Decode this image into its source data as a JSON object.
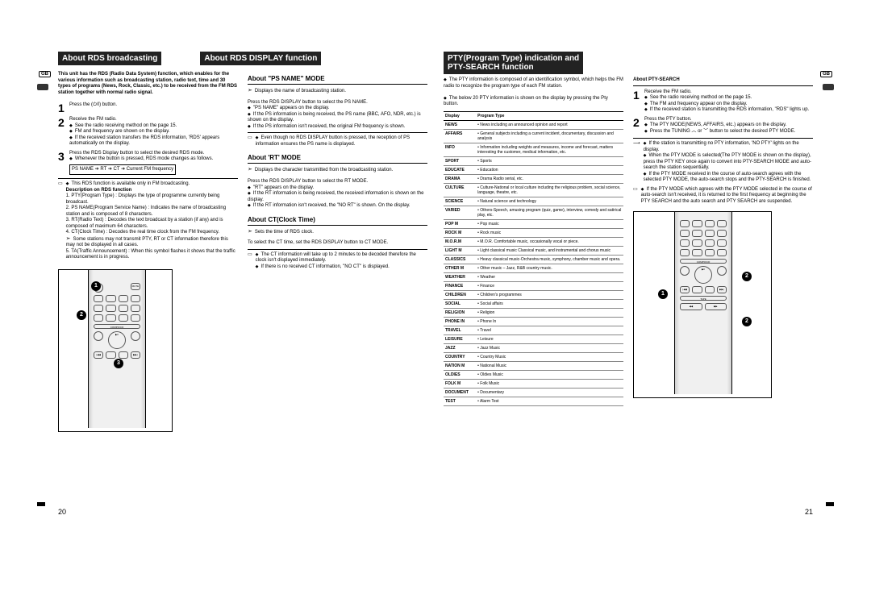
{
  "page_left_number": "20",
  "page_right_number": "21",
  "gb_badge": "GB",
  "headers": {
    "h1": "About RDS broadcasting",
    "h2": "About RDS DISPLAY function",
    "h3a": "PTY(Program Type) indication and",
    "h3b": "PTY-SEARCH function"
  },
  "left_intro": "This unit has the RDS (Radio Data System) function, which enables for the various information such as broadcasting station, radio text, time and 30 types of programs (News, Rock, Classic, etc.) to be received from the FM RDS station together with normal radio signal.",
  "left_steps": {
    "s1": "Press the (⏻/I) button.",
    "s2_a": "Receive the FM radio.",
    "s2_b": "See the radio receiving method on the page 15.",
    "s2_c": "FM and frequency are shown on the display.",
    "s2_d": "If the received station transfers the RDS information, 'RDS' appears automatically on the display.",
    "s3_a": "Press the RDS Display button to select the desired RDS mode.",
    "s3_b": "Whenever the button is pressed, RDS mode changes as follows.",
    "s3_flow": "PS NAME ➔ RT ➔ CT ➔ Current FM frequency"
  },
  "left_notes": {
    "intro": "This RDS function is available only in FM broadcasting.",
    "desc_head": "Description on RDS function",
    "n1": "1. PTY(Program Type) : Displays the type of programme currently being broadcast.",
    "n2": "2. PS NAME(Program Service Name) : Indicates the name of broadcasting station and is composed of 8 characters.",
    "n3": "3. RT(Radio Text) : Decodes the text broadcast by a station (if any) and is composed of maximum 64 characters.",
    "n4": "4. CT(Clock Time) : Decodes the real time clock from the FM frequency.",
    "n4b": "Some stations may not transmit PTY, RT or CT information therefore this may not be displayed in all cases.",
    "n5": "5. TA(Traffic Announcement) : When this symbol flashes it shows that the traffic announcement is in progress."
  },
  "mid_ps": {
    "head": "About \"PS NAME\" MODE",
    "p1": "Displays the name of broadcasting station.",
    "p2": "Press the RDS DISPLAY button to select the PS NAME.",
    "p3": "\"PS NAME\" appears on the display.",
    "p4": "If the PS information is being received, the PS name (BBC, AFO, NDR, etc.) is shown on the display.",
    "p5": "If the PS information isn't received, the original FM frequency is shown.",
    "note": "Even though no RDS DISPLAY button is pressed, the reception of PS information ensures the PS name is displayed."
  },
  "mid_rt": {
    "head": "About 'RT' MODE",
    "p1": "Displays the character transmitted from the broadcasting station.",
    "p2": "Press the RDS DISPLAY button to select the RT MODE.",
    "p3": "\"RT\" appears on the display.",
    "p4": "If the RT information is being received, the received information is shown on the display.",
    "p5": "If the RT information isn't received, the \"NO RT\" is shown. On the display."
  },
  "mid_ct": {
    "head": "About CT(Clock Time)",
    "p1": "Sets the time of RDS clock.",
    "p2": "To select the CT time, set the RDS DISPLAY button to CT MODE.",
    "n1": "The CT information will take up to 2 minutes to be decoded therefore the clock isn't displayed immediately.",
    "n2": "If there is no received CT information, \"NO CT\" is displayed."
  },
  "right_intro": {
    "p1": "The PTY information is composed of an identification symbol, which helps the FM radio to recognize the program type of each FM station.",
    "p2": "The below 20 PTY information is shown on the display by pressing the Pty button."
  },
  "pty_table_headers": {
    "c1": "Display",
    "c2": "Program Type"
  },
  "pty_table": [
    {
      "d": "NEWS",
      "p": "• News including an announced opinion and report"
    },
    {
      "d": "AFFAIRS",
      "p": "• General subjects including a current incident, documentary, discussion and analysis"
    },
    {
      "d": "INFO",
      "p": "• Information including weights and measures, income and forecast, matters interesting the customer, medical information, etc."
    },
    {
      "d": "SPORT",
      "p": "• Sports"
    },
    {
      "d": "EDUCATE",
      "p": "• Education"
    },
    {
      "d": "DRAMA",
      "p": "• Drama Radio serial, etc."
    },
    {
      "d": "CULTURE",
      "p": "• Culture-National or local culture including the religious problem, social science, language, theatre, etc."
    },
    {
      "d": "SCIENCE",
      "p": "• Natural science and technology"
    },
    {
      "d": "VARIED",
      "p": "• Others-Speech, amusing program (quiz, game), interview, comedy and satirical play, etc."
    },
    {
      "d": "POP M",
      "p": "• Pop music"
    },
    {
      "d": "ROCK M",
      "p": "• Rock music"
    },
    {
      "d": "M.O.R.M",
      "p": "• M.O.R. Comfortable music, occasionally vocal or piece."
    },
    {
      "d": "LIGHT M",
      "p": "• Light classical music Classical music, and instrumental and chorus music"
    },
    {
      "d": "CLASSICS",
      "p": "• Heavy classical  music-Orchestra music, symphony, chamber music and opera."
    },
    {
      "d": "OTHER M",
      "p": "• Other music – Jazz, R&B country music."
    },
    {
      "d": "WEATHER",
      "p": "• Weather"
    },
    {
      "d": "FINANCE",
      "p": "• Finance"
    },
    {
      "d": "CHILDREN",
      "p": "• Children's programmes"
    },
    {
      "d": "SOCIAL",
      "p": "• Social affairs"
    },
    {
      "d": "RELIGION",
      "p": "• Religion"
    },
    {
      "d": "PHONE IN",
      "p": "• Phone In"
    },
    {
      "d": "TRAVEL",
      "p": "• Travel"
    },
    {
      "d": "LEISURE",
      "p": "• Leisure"
    },
    {
      "d": "JAZZ",
      "p": "• Jazz Music"
    },
    {
      "d": "COUNTRY",
      "p": "• Country Music"
    },
    {
      "d": "NATION M",
      "p": "• National Music"
    },
    {
      "d": "OLDIES",
      "p": "• Oldies Music"
    },
    {
      "d": "FOLK M",
      "p": "• Folk Music"
    },
    {
      "d": "DOCUMENT",
      "p": "• Documentary"
    },
    {
      "d": "TEST",
      "p": "• Alarm Test"
    }
  ],
  "right_search": {
    "head": "About PTY-SEARCH",
    "s1_a": "Receive the FM radio.",
    "s1_b": "See the radio receiving method on the page 15.",
    "s1_c": "The FM and frequency appear on the display.",
    "s1_d": "If the received station is transmitting the RDS information, \"RDS\" lights up.",
    "s2_a": "Press the PTY button.",
    "s2_b": "The PTY MODE(NEWS, AFFAIRS, etc.) appears on the display.",
    "s2_c": "Press the TUNING ︿ or ﹀ button to select the desired PTY MODE.",
    "n1": "If the station is transmitting no PTY information, 'NO PTY' lights on the display.",
    "n2": "When the PTY MODE is selected(The PTY MODE is shown on the display), press the PTY KEY once again to convert into PTY-SEARCH MODE and auto-search the station sequentially.",
    "n3": "If the PTY MODE received in the course of auto-search agrees with the selected PTY MODE, the auto-search stops and the PTY-SEARCH is finished.",
    "n4": "If the PTY MODE which agrees with the PTY MODE selected in the course of auto-search  isn't received, it is returned to the first frequency at beginning the PTY SEARCH and the auto search and PTY SEARCH are suspended."
  }
}
